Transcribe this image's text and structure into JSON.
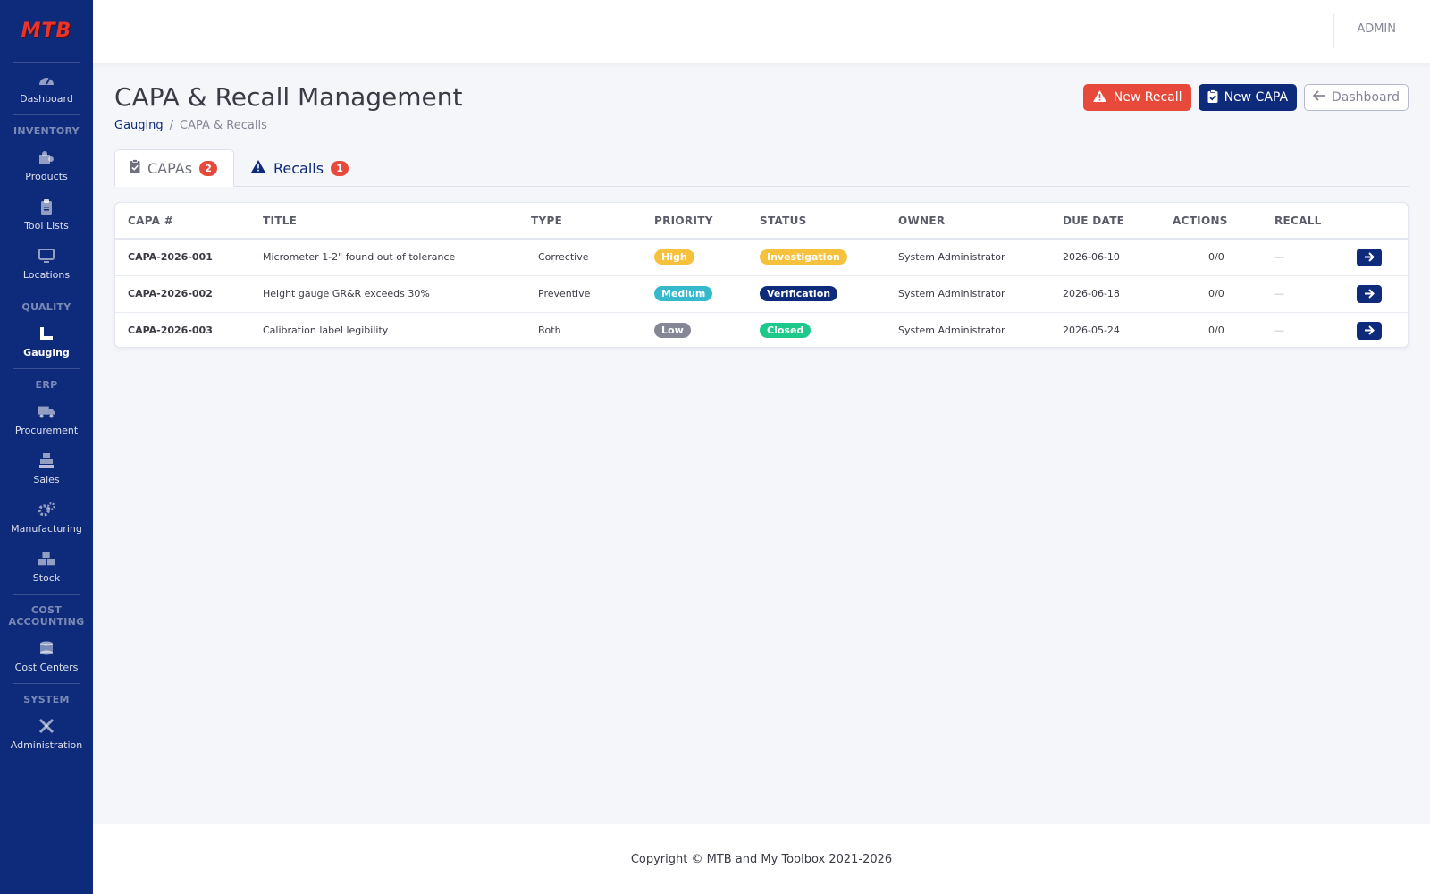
{
  "brand": {
    "logo_text": "MTB"
  },
  "sidebar": {
    "items": [
      {
        "label": "Dashboard",
        "icon": "gauge-icon"
      },
      {
        "section": "INVENTORY"
      },
      {
        "label": "Products",
        "icon": "puzzle-icon"
      },
      {
        "label": "Tool Lists",
        "icon": "clipboard-icon"
      },
      {
        "label": "Locations",
        "icon": "monitor-icon"
      },
      {
        "section": "QUALITY"
      },
      {
        "label": "Gauging",
        "icon": "ruler-icon",
        "active": true
      },
      {
        "section": "ERP"
      },
      {
        "label": "Procurement",
        "icon": "truck-icon"
      },
      {
        "label": "Sales",
        "icon": "cash-register-icon"
      },
      {
        "label": "Manufacturing",
        "icon": "cogs-icon"
      },
      {
        "label": "Stock",
        "icon": "boxes-icon"
      },
      {
        "section": "COST ACCOUNTING"
      },
      {
        "label": "Cost Centers",
        "icon": "coins-icon"
      },
      {
        "section": "SYSTEM"
      },
      {
        "label": "Administration",
        "icon": "tools-icon"
      }
    ]
  },
  "topbar": {
    "user": "ADMIN"
  },
  "page": {
    "title": "CAPA & Recall Management",
    "breadcrumb": [
      "Gauging",
      "CAPA & Recalls"
    ]
  },
  "toolbar": {
    "new_recall_label": "New Recall",
    "new_capa_label": "New CAPA",
    "dashboard_label": "Dashboard"
  },
  "tabs": [
    {
      "label": "CAPAs",
      "count": "2",
      "active": true
    },
    {
      "label": "Recalls",
      "count": "1",
      "active": false
    }
  ],
  "table": {
    "headers": [
      "CAPA #",
      "TITLE",
      "TYPE",
      "PRIORITY",
      "STATUS",
      "OWNER",
      "DUE DATE",
      "ACTIONS",
      "RECALL"
    ],
    "rows": [
      {
        "num": "CAPA-2026-001",
        "title": "Micrometer 1-2\" found out of tolerance",
        "type": "Corrective",
        "priority": "High",
        "status": "Investigation",
        "owner": "System Administrator",
        "due": "2026-06-10",
        "actions": "0/0",
        "recall": "—"
      },
      {
        "num": "CAPA-2026-002",
        "title": "Height gauge GR&R exceeds 30%",
        "type": "Preventive",
        "priority": "Medium",
        "status": "Verification",
        "owner": "System Administrator",
        "due": "2026-06-18",
        "actions": "0/0",
        "recall": "—"
      },
      {
        "num": "CAPA-2026-003",
        "title": "Calibration label legibility",
        "type": "Both",
        "priority": "Low",
        "status": "Closed",
        "owner": "System Administrator",
        "due": "2026-05-24",
        "actions": "0/0",
        "recall": "—"
      }
    ]
  },
  "colors": {
    "sidebar": "#0e2a7a",
    "priority_high": "#f6c23e",
    "priority_medium": "#36b9cc",
    "priority_low": "#858796",
    "status_investigation": "#f6c23e",
    "status_verification": "#0e2a7a",
    "status_closed": "#1cc88a",
    "danger": "#e74a3b"
  },
  "footer": {
    "text": "Copyright © MTB and My Toolbox 2021-2026"
  }
}
